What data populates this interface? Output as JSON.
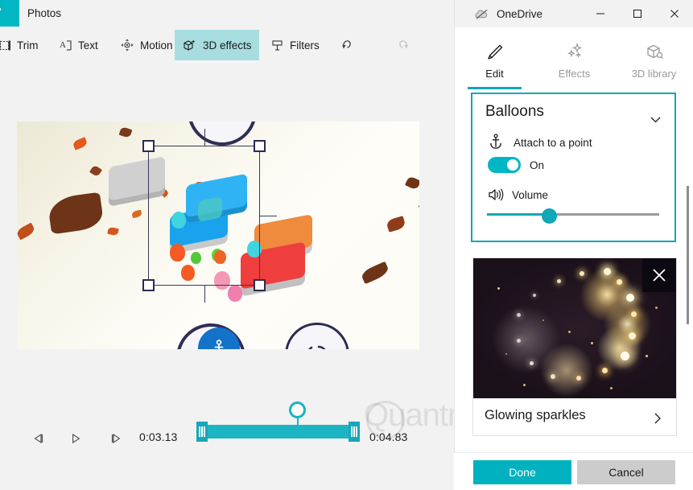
{
  "window": {
    "app_title": "Photos",
    "app_icon": "photos-app-icon"
  },
  "toolbar": {
    "items": [
      {
        "label": "Trim",
        "icon": "trim-icon",
        "active": false
      },
      {
        "label": "Text",
        "icon": "text-icon",
        "active": false
      },
      {
        "label": "Motion",
        "icon": "motion-icon",
        "active": false
      },
      {
        "label": "3D effects",
        "icon": "cube-sparkle-icon",
        "active": true
      },
      {
        "label": "Filters",
        "icon": "filters-icon",
        "active": false
      }
    ],
    "undo_icon": "undo-icon",
    "redo_icon": "redo-icon"
  },
  "transport": {
    "prev_frame_icon": "previous-frame-icon",
    "play_icon": "play-icon",
    "next_frame_icon": "next-frame-icon",
    "current_time": "0:03.13",
    "end_time": "0:04.83"
  },
  "watermark": {
    "text": "Quantrimang",
    "logo": "lightbulb-icon"
  },
  "flyout": {
    "title": "OneDrive",
    "title_icon": "onedrive-offline-cloud-icon",
    "minimize_icon": "minimize-icon",
    "maximize_icon": "maximize-icon",
    "close_icon": "close-icon",
    "tabs": [
      {
        "label": "Edit",
        "icon": "pencil-icon",
        "selected": true
      },
      {
        "label": "Effects",
        "icon": "sparkles-icon",
        "selected": false
      },
      {
        "label": "3D library",
        "icon": "cube-search-icon",
        "selected": false
      }
    ]
  },
  "balloons_card": {
    "title": "Balloons",
    "collapse_icon": "chevron-down-icon",
    "attach": {
      "label": "Attach to a point",
      "icon": "anchor-icon",
      "toggle_state": "On"
    },
    "volume": {
      "label": "Volume",
      "icon": "volume-icon",
      "value_percent": 37
    }
  },
  "effect_card": {
    "name": "Glowing sparkles",
    "close_icon": "close-icon",
    "more_icon": "chevron-right-icon",
    "thumbnail": "glowing-sparkles-thumbnail"
  },
  "footer": {
    "done_label": "Done",
    "cancel_label": "Cancel"
  },
  "colors": {
    "accent_teal": "#00b7c3",
    "tab_underline": "#11a7b5",
    "active_tool_bg": "#a8dde0",
    "done_button": "#00b2c0",
    "cancel_button": "#cccccc",
    "window_bg": "#f2f2f2"
  }
}
